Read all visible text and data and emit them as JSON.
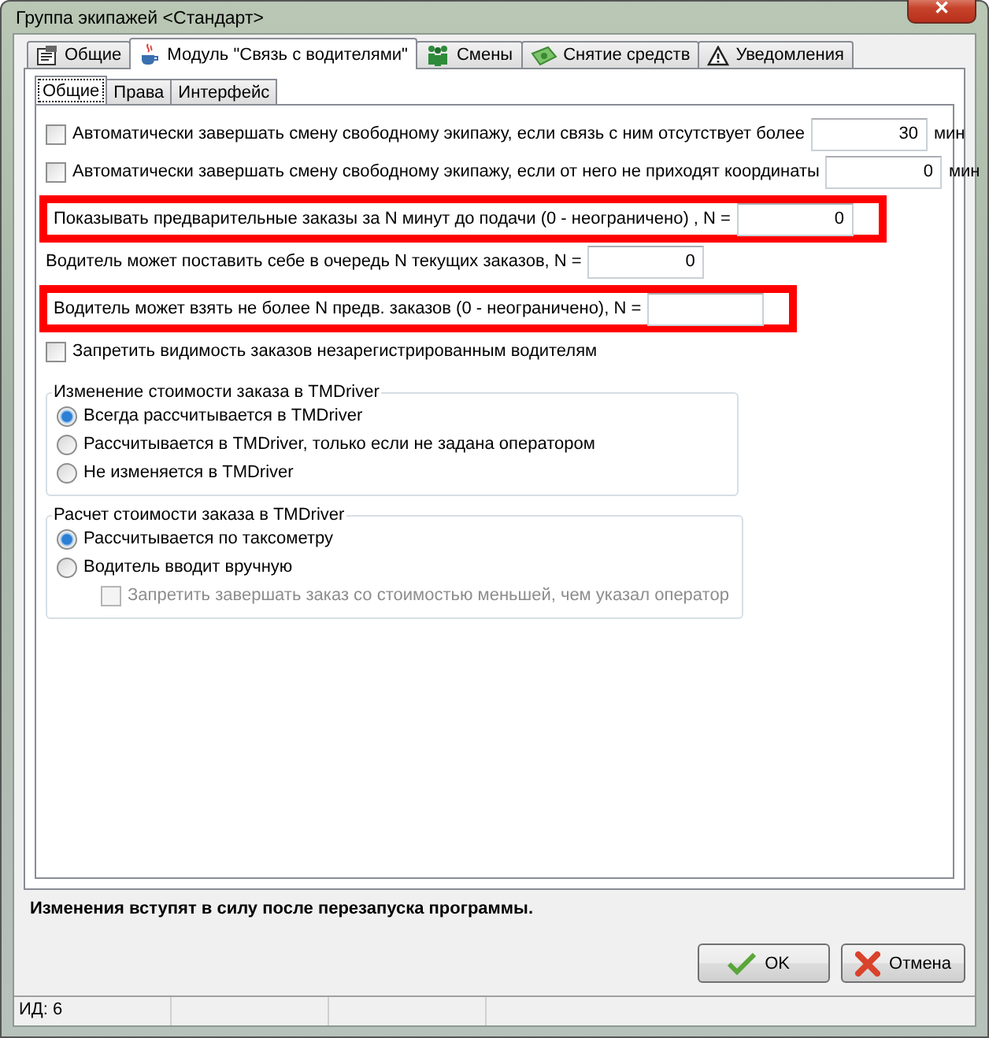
{
  "window": {
    "title": "Группа экипажей <Стандарт>",
    "close": "✕"
  },
  "tabs": [
    {
      "label": "Общие",
      "selected": false
    },
    {
      "label": "Модуль \"Связь с водителями\"",
      "selected": true
    },
    {
      "label": "Смены",
      "selected": false
    },
    {
      "label": "Снятие средств",
      "selected": false
    },
    {
      "label": "Уведомления",
      "selected": false
    }
  ],
  "subtabs": [
    {
      "label": "Общие",
      "selected": true
    },
    {
      "label": "Права",
      "selected": false
    },
    {
      "label": "Интерфейс",
      "selected": false
    }
  ],
  "settings": [
    {
      "kind": "checkbox",
      "label": "Автоматически завершать смену свободному экипажу, если связь с ним отсутствует более",
      "checked": false,
      "value": "30",
      "unit": "мин",
      "highlighted": false
    },
    {
      "kind": "checkbox",
      "label": "Автоматически завершать смену свободному экипажу, если от него не приходят координаты",
      "checked": false,
      "value": "0",
      "unit": "мин",
      "highlighted": false
    },
    {
      "kind": "number",
      "label": "Показывать предварительные заказы за N минут до подачи (0 - неограничено) , N =",
      "value": "0",
      "highlighted": true
    },
    {
      "kind": "number",
      "label": "Водитель может поставить себе в очередь N текущих заказов, N =",
      "value": "0",
      "highlighted": false
    },
    {
      "kind": "number",
      "label": "Водитель может взять не более N предв. заказов (0 - неограничено), N =",
      "highlighted": true
    },
    {
      "kind": "toggle",
      "label": "Запретить видимость заказов незарегистрированным водителям",
      "checked": false,
      "highlighted": false
    }
  ],
  "groups": [
    {
      "title": "Изменение стоимости заказа в TMDriver",
      "options": [
        {
          "kind": "radio",
          "label": "Всегда рассчитывается в TMDriver",
          "selected": true
        },
        {
          "kind": "radio",
          "label": "Рассчитывается в TMDriver, только если не задана оператором",
          "selected": false
        },
        {
          "kind": "radio",
          "label": "Не изменяется в TMDriver",
          "selected": false
        }
      ]
    },
    {
      "title": "Расчет стоимости заказа в TMDriver",
      "options": [
        {
          "kind": "radio",
          "label": "Рассчитывается по таксометру",
          "selected": true
        },
        {
          "kind": "radio",
          "label": "Водитель вводит вручную",
          "selected": false
        },
        {
          "kind": "checkbox",
          "label": "Запретить завершать заказ со стоимостью меньшей, чем указал оператор",
          "checked": false,
          "disabled": true
        }
      ]
    }
  ],
  "notice": "Изменения вступят в силу после перезапуска программы.",
  "buttons": [
    {
      "label": "OK"
    },
    {
      "label": "Отмена"
    }
  ],
  "status_bar": [
    "ИД: 6"
  ]
}
